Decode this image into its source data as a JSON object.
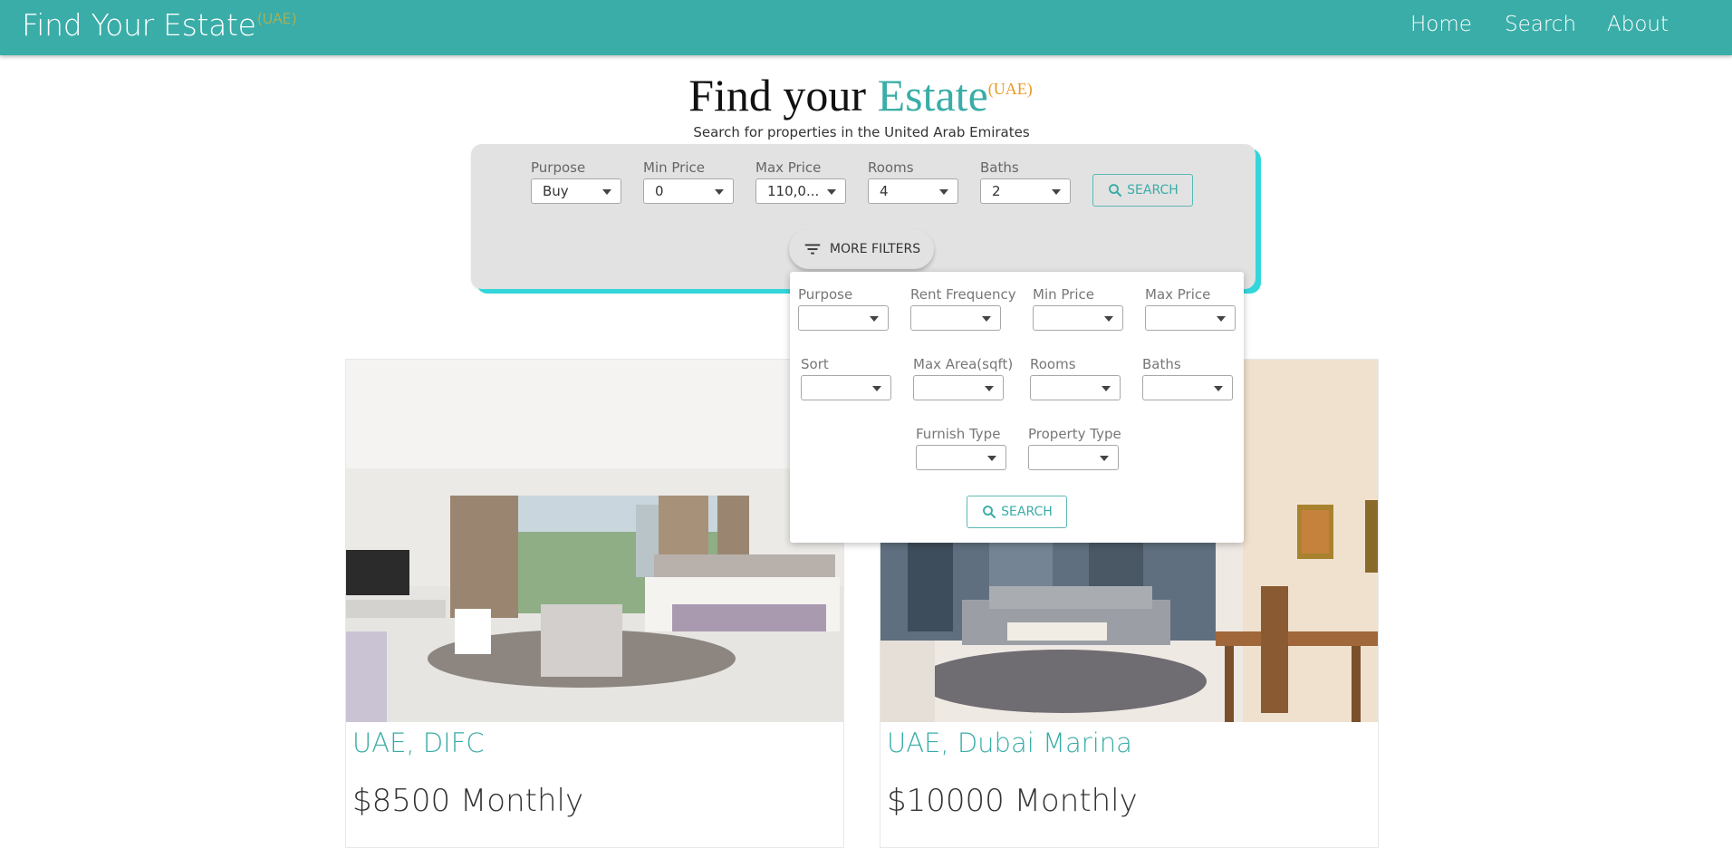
{
  "navbar": {
    "brand": "Find Your Estate",
    "brand_sup": "(UAE)",
    "links": [
      "Home",
      "Search",
      "About"
    ]
  },
  "hero": {
    "title_a": "Find your ",
    "title_b": "Estate",
    "title_sup": "(UAE)",
    "subtitle": "Search for properties in the United Arab Emirates"
  },
  "search": {
    "fields": [
      {
        "label": "Purpose",
        "value": "Buy"
      },
      {
        "label": "Min Price",
        "value": "0"
      },
      {
        "label": "Max Price",
        "value": "110,0..."
      },
      {
        "label": "Rooms",
        "value": "4"
      },
      {
        "label": "Baths",
        "value": "2"
      }
    ],
    "button": "SEARCH",
    "more_filters": "MORE FILTERS"
  },
  "filters_popover": {
    "fields": [
      {
        "label": "Purpose",
        "value": ""
      },
      {
        "label": "Rent Frequency",
        "value": ""
      },
      {
        "label": "Min Price",
        "value": ""
      },
      {
        "label": "Max Price",
        "value": ""
      },
      {
        "label": "Sort",
        "value": ""
      },
      {
        "label": "Max Area(sqft)",
        "value": ""
      },
      {
        "label": "Rooms",
        "value": ""
      },
      {
        "label": "Baths",
        "value": ""
      },
      {
        "label": "Furnish Type",
        "value": ""
      },
      {
        "label": "Property Type",
        "value": ""
      }
    ],
    "button": "SEARCH"
  },
  "listings": [
    {
      "location": "UAE, DIFC",
      "price": "$8500 Monthly"
    },
    {
      "location": "UAE, Dubai Marina",
      "price": "$10000 Monthly"
    }
  ],
  "colors": {
    "primary": "#3aada8",
    "accent": "#f5b51c",
    "panel": "#e2e2e2",
    "panel_shadow": "#33d6db"
  }
}
